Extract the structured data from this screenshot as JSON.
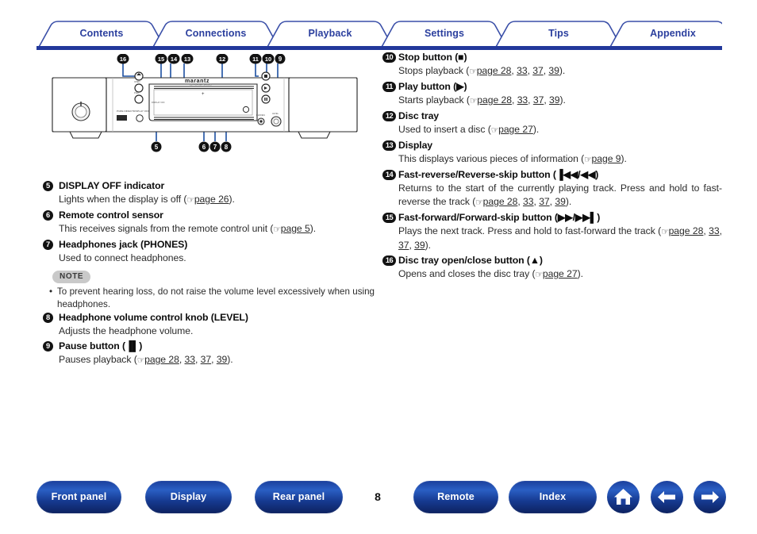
{
  "tabs": [
    {
      "label": "Contents"
    },
    {
      "label": "Connections"
    },
    {
      "label": "Playback"
    },
    {
      "label": "Settings"
    },
    {
      "label": "Tips"
    },
    {
      "label": "Appendix"
    }
  ],
  "colors": {
    "tab_text": "#2b3f9e",
    "tab_outline": "#3a4fa8",
    "tab_underline": "#22389b",
    "button_blue": "#1b3f9c",
    "marker_black": "#121212",
    "note_badge_bg": "#c9c9c9"
  },
  "device": {
    "brand": "marantz",
    "brand_sub": "CD PLAYER SA8005",
    "callouts_top": [
      "16",
      "15",
      "14",
      "13",
      "12",
      "11",
      "10",
      "9"
    ],
    "callouts_bottom": [
      "5",
      "6",
      "7",
      "8"
    ],
    "panel_labels": [
      "POWER",
      "LEVEL",
      "PHONES",
      "DISPLAY OFF"
    ]
  },
  "left_column": [
    {
      "marker": "5",
      "marker_kind": "single",
      "title": "DISPLAY OFF indicator",
      "body_pre": "Lights when the display is off (",
      "links": [
        "page 26"
      ],
      "body_post": ")."
    },
    {
      "marker": "6",
      "marker_kind": "single",
      "title": "Remote control sensor",
      "body_pre": "This receives signals from the remote control unit (",
      "links": [
        "page 5"
      ],
      "body_post": ")."
    },
    {
      "marker": "7",
      "marker_kind": "single",
      "title": "Headphones jack (PHONES)",
      "body_pre": "Used to connect headphones.",
      "links": [],
      "body_post": ""
    },
    {
      "marker": "8",
      "marker_kind": "single",
      "title": "Headphone volume control knob (LEVEL)",
      "body_pre": "Adjusts the headphone volume.",
      "links": [],
      "body_post": ""
    },
    {
      "marker": "9",
      "marker_kind": "single",
      "title": "Pause button (▐▌)",
      "body_pre": "Pauses playback (",
      "links": [
        "page 28",
        "33",
        "37",
        "39"
      ],
      "body_post": ")."
    }
  ],
  "note": {
    "badge": "NOTE",
    "bullet": "•",
    "text": "To prevent hearing loss, do not raise the volume level excessively when using headphones."
  },
  "right_column": [
    {
      "marker": "10",
      "marker_kind": "double",
      "title": "Stop button (■)",
      "body_pre": "Stops playback (",
      "links": [
        "page 28",
        "33",
        "37",
        "39"
      ],
      "body_post": ").",
      "justify": false
    },
    {
      "marker": "11",
      "marker_kind": "double",
      "title": "Play button (▶)",
      "body_pre": "Starts playback (",
      "links": [
        "page 28",
        "33",
        "37",
        "39"
      ],
      "body_post": ").",
      "justify": false
    },
    {
      "marker": "12",
      "marker_kind": "double",
      "title": "Disc tray",
      "body_pre": "Used to insert a disc (",
      "links": [
        "page 27"
      ],
      "body_post": ").",
      "justify": false
    },
    {
      "marker": "13",
      "marker_kind": "double",
      "title": "Display",
      "body_pre": "This displays various pieces of information (",
      "links": [
        "page 9"
      ],
      "body_post": ").",
      "justify": false
    },
    {
      "marker": "14",
      "marker_kind": "double",
      "title": "Fast-reverse/Reverse-skip button (▐◀◀/◀◀)",
      "body_pre": "Returns to the start of the currently playing track. Press and hold to fast-reverse the track (",
      "links": [
        "page 28",
        "33",
        "37",
        "39"
      ],
      "body_post": ").",
      "justify": true
    },
    {
      "marker": "15",
      "marker_kind": "double",
      "title": "Fast-forward/Forward-skip button (▶▶/▶▶▌)",
      "body_pre": "Plays the next track. Press and hold to fast-forward the track (",
      "links": [
        "page 28",
        "33",
        "37",
        "39"
      ],
      "body_post": ").",
      "justify": true
    },
    {
      "marker": "16",
      "marker_kind": "double",
      "title": "Disc tray open/close button (▲)",
      "body_pre": "Opens and closes the disc tray (",
      "links": [
        "page 27"
      ],
      "body_post": ").",
      "justify": false
    }
  ],
  "footer": {
    "buttons": [
      {
        "label": "Front panel"
      },
      {
        "label": "Display"
      },
      {
        "label": "Rear panel"
      },
      {
        "label": "Remote"
      },
      {
        "label": "Index"
      }
    ],
    "icon_buttons": [
      {
        "name": "home-icon"
      },
      {
        "name": "back-arrow-icon"
      },
      {
        "name": "forward-arrow-icon"
      }
    ],
    "page_number": "8"
  }
}
